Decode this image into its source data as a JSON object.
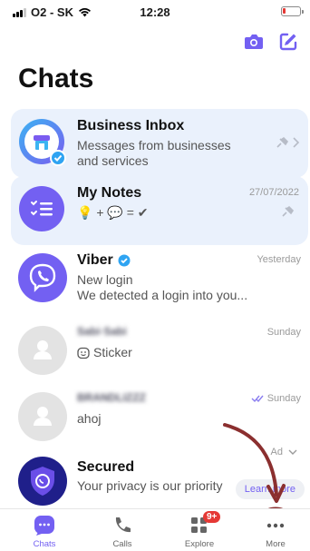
{
  "status_bar": {
    "carrier": "O2 - SK",
    "time": "12:28"
  },
  "title": "Chats",
  "chats": [
    {
      "name": "Business Inbox",
      "preview": "Messages from businesses and services",
      "date": "",
      "pinned": true
    },
    {
      "name": "My Notes",
      "preview": "💡 + 💬 = ✔",
      "date": "27/07/2022",
      "pinned": true
    },
    {
      "name": "Viber",
      "preview_line1": "New login",
      "preview_line2": "We detected a login into you...",
      "date": "Yesterday"
    },
    {
      "name": "Sabi·Sabi",
      "preview": "Sticker",
      "date": "Sunday"
    },
    {
      "name": "BRANDLIZZZ",
      "preview": "ahoj",
      "date": "Sunday"
    }
  ],
  "ad": {
    "label": "Ad",
    "name": "Secured",
    "text": "Your privacy is our priority",
    "cta": "Learn more"
  },
  "tabs": [
    {
      "label": "Chats"
    },
    {
      "label": "Calls"
    },
    {
      "label": "Explore",
      "badge": "9+"
    },
    {
      "label": "More"
    }
  ],
  "colors": {
    "accent": "#7360f2",
    "pinned_bg": "#eaf1fc",
    "badge": "#e53935",
    "annotation": "#8b2f2f"
  }
}
